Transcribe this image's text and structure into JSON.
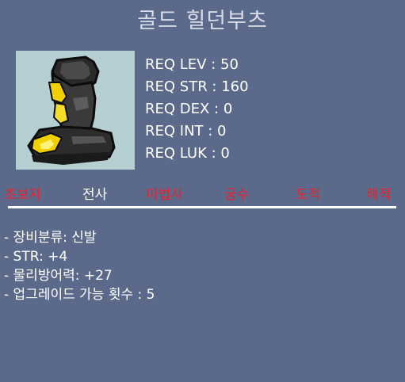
{
  "item": {
    "name": "골드 힐던부츠",
    "image_icon": "gold-boot-icon"
  },
  "requirements": [
    {
      "label": "REQ LEV : 50"
    },
    {
      "label": "REQ STR : 160"
    },
    {
      "label": "REQ DEX : 0"
    },
    {
      "label": "REQ INT : 0"
    },
    {
      "label": "REQ LUK : 0"
    }
  ],
  "classes": [
    {
      "label": "초보자",
      "allowed": false
    },
    {
      "label": "전사",
      "allowed": true
    },
    {
      "label": "마법사",
      "allowed": false
    },
    {
      "label": "궁수",
      "allowed": false
    },
    {
      "label": "도적",
      "allowed": false
    },
    {
      "label": "해적",
      "allowed": false
    }
  ],
  "colors": {
    "background": "#5b6a8a",
    "title": "#d8dce6",
    "allowed": "#ffffff",
    "not_allowed": "#e8212e",
    "image_bg": "#b6cfd2"
  },
  "stats": [
    {
      "text": "- 장비분류: 신발"
    },
    {
      "text": "- STR: +4"
    },
    {
      "text": "- 물리방어력: +27"
    },
    {
      "text": "- 업그레이드 가능 횟수 : 5"
    }
  ]
}
